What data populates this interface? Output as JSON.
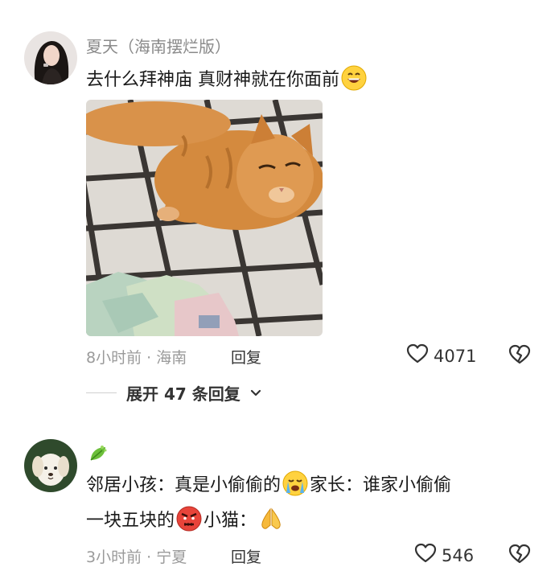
{
  "comments": [
    {
      "username": "夏天（海南摆烂版）",
      "text": "去什么拜神庙 真财神就在你面前",
      "time": "8小时前",
      "location": "海南",
      "reply_label": "回复",
      "likes": "4071",
      "expand_label": "展开 47 条回复"
    },
    {
      "text_line1_a": "邻居小孩：真是小偷偷的",
      "text_line1_b": "家长：谁家小偷偷",
      "text_line2_a": "一块五块的",
      "text_line2_b": "小猫：",
      "time": "3小时前",
      "location": "宁夏",
      "reply_label": "回复",
      "likes": "546"
    }
  ],
  "separator": "·",
  "icons": {
    "like": "heart-outline-icon",
    "dislike": "broken-heart-icon",
    "expand": "chevron-down-icon"
  }
}
